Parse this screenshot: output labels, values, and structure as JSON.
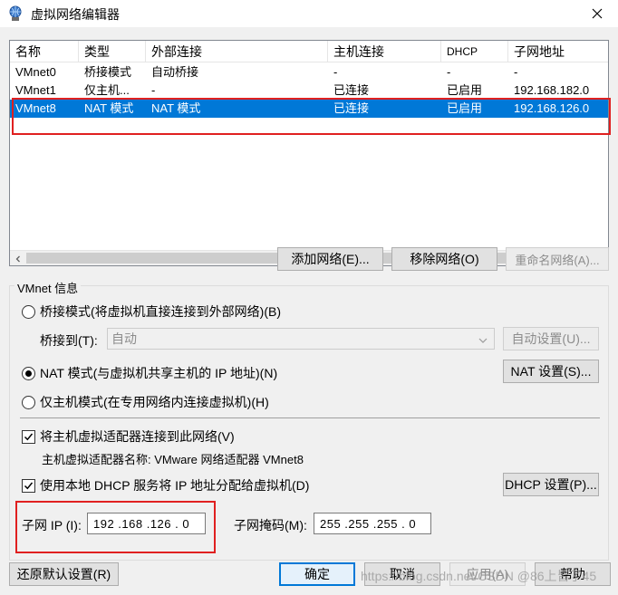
{
  "window": {
    "title": "虚拟网络编辑器",
    "close_symbol": "✕"
  },
  "network_list": {
    "columns": [
      "名称",
      "类型",
      "外部连接",
      "主机连接",
      "DHCP",
      "子网地址"
    ],
    "rows": [
      {
        "name": "VMnet0",
        "type": "桥接模式",
        "external": "自动桥接",
        "host": "-",
        "dhcp": "-",
        "subnet": "-"
      },
      {
        "name": "VMnet1",
        "type": "仅主机...",
        "external": "-",
        "host": "已连接",
        "dhcp": "已启用",
        "subnet": "192.168.182.0"
      },
      {
        "name": "VMnet8",
        "type": "NAT 模式",
        "external": "NAT 模式",
        "host": "已连接",
        "dhcp": "已启用",
        "subnet": "192.168.126.0"
      }
    ]
  },
  "list_buttons": {
    "add": "添加网络(E)...",
    "remove": "移除网络(O)",
    "rename": "重命名网络(A)..."
  },
  "vmnet_info": {
    "legend": "VMnet 信息",
    "bridged_radio": "桥接模式(将虚拟机直接连接到外部网络)(B)",
    "bridged_to_label": "桥接到(T):",
    "bridged_to_value": "自动",
    "auto_settings": "自动设置(U)...",
    "nat_radio": "NAT 模式(与虚拟机共享主机的 IP 地址)(N)",
    "nat_settings": "NAT 设置(S)...",
    "hostonly_radio": "仅主机模式(在专用网络内连接虚拟机)(H)",
    "connect_adapter_check": "将主机虚拟适配器连接到此网络(V)",
    "adapter_name": "主机虚拟适配器名称: VMware 网络适配器 VMnet8",
    "dhcp_check": "使用本地 DHCP 服务将 IP 地址分配给虚拟机(D)",
    "dhcp_settings": "DHCP 设置(P)...",
    "subnet_ip_label": "子网 IP (I):",
    "subnet_ip_value": "192 .168 .126 . 0",
    "subnet_mask_label": "子网掩码(M):",
    "subnet_mask_value": "255 .255 .255 . 0"
  },
  "bottom_buttons": {
    "restore": "还原默认设置(R)",
    "ok": "确定",
    "cancel": "取消",
    "apply": "应用(A)",
    "help": "帮助"
  },
  "watermark": "https://blog.csdn.net/CSDN @86上皆了45"
}
